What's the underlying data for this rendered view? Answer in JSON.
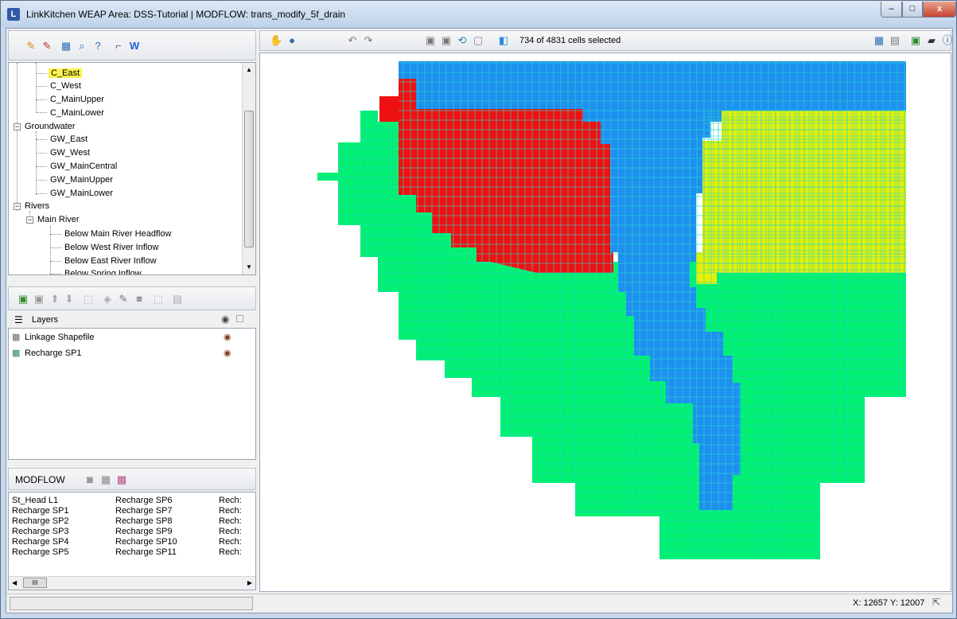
{
  "window": {
    "title": "LinkKitchen   WEAP Area: DSS-Tutorial | MODFLOW: trans_modify_5f_drain",
    "icon_letter": "L",
    "min_label": "–",
    "max_label": "□",
    "close_label": "x"
  },
  "tree": {
    "items": [
      {
        "label": "C_East",
        "selected": true
      },
      {
        "label": "C_West"
      },
      {
        "label": "C_MainUpper"
      },
      {
        "label": "C_MainLower"
      },
      {
        "label": "Groundwater"
      },
      {
        "label": "GW_East"
      },
      {
        "label": "GW_West"
      },
      {
        "label": "GW_MainCentral"
      },
      {
        "label": "GW_MainUpper"
      },
      {
        "label": "GW_MainLower"
      },
      {
        "label": "Rivers"
      },
      {
        "label": "Main River"
      },
      {
        "label": "Below Main River Headflow"
      },
      {
        "label": "Below West River Inflow"
      },
      {
        "label": "Below East River Inflow"
      },
      {
        "label": "Below Spring Inflow"
      }
    ]
  },
  "layers": {
    "header": "Layers",
    "items": [
      {
        "label": "Linkage Shapefile"
      },
      {
        "label": "Recharge SP1"
      }
    ]
  },
  "modflow": {
    "label": "MODFLOW",
    "col1": [
      "St_Head L1",
      "Recharge SP1",
      "Recharge SP2",
      "Recharge SP3",
      "Recharge SP4",
      "Recharge SP5"
    ],
    "col2": [
      "Recharge SP6",
      "Recharge SP7",
      "Recharge SP8",
      "Recharge SP9",
      "Recharge SP10",
      "Recharge SP11"
    ],
    "col3": [
      "Rech:",
      "Rech:",
      "Rech:",
      "Rech:",
      "Rech:",
      "Rech:"
    ],
    "scroll_thumb": "III"
  },
  "map": {
    "cells_selected": "734 of 4831 cells selected",
    "colors": {
      "blue": "#1e90f0",
      "red": "#ee1111",
      "yellow": "#e8f000",
      "green": "#00f070",
      "gridline": "#25d8c8"
    }
  },
  "status": {
    "coords": "X: 12657  Y: 12007"
  }
}
